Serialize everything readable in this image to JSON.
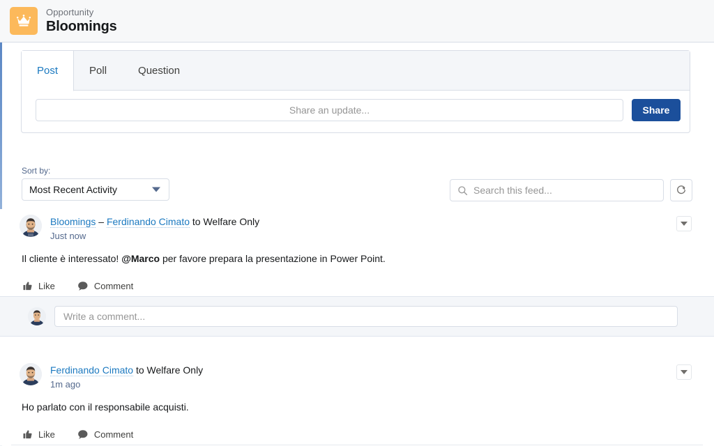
{
  "header": {
    "object_label": "Opportunity",
    "record_name": "Bloomings",
    "icon": "crown-icon",
    "icon_color": "#fcb95b"
  },
  "publisher": {
    "tabs": [
      {
        "label": "Post",
        "active": true
      },
      {
        "label": "Poll",
        "active": false
      },
      {
        "label": "Question",
        "active": false
      }
    ],
    "input_placeholder": "Share an update...",
    "share_label": "Share",
    "share_color": "#1b4f9b"
  },
  "feed_controls": {
    "sort_label": "Sort by:",
    "sort_value": "Most Recent Activity",
    "search_placeholder": "Search this feed...",
    "search_value": "",
    "refresh_icon": "refresh-icon"
  },
  "feed": [
    {
      "author": "Bloomings",
      "separator": "–",
      "coauthor": "Ferdinando Cimato",
      "to_text": "to Welfare Only",
      "timestamp": "Just now",
      "body_pre": "Il cliente è interessato! ",
      "body_mention": "@Marco",
      "body_post": " per favore prepara la presentazione in Power Point.",
      "like_label": "Like",
      "comment_label": "Comment",
      "comment_placeholder": "Write a comment..."
    },
    {
      "author": "Ferdinando Cimato",
      "to_text": "to Welfare Only",
      "timestamp": "1m ago",
      "body": "Ho parlato con il responsabile acquisti.",
      "like_label": "Like",
      "comment_label": "Comment"
    }
  ]
}
